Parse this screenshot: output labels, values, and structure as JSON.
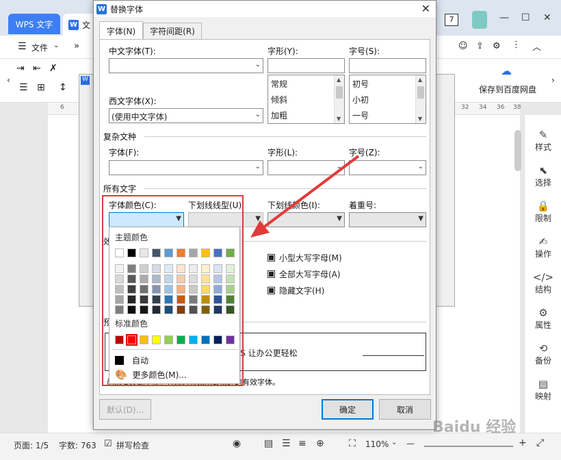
{
  "app": {
    "tab_wps": "WPS 文字",
    "tab_doc": "文",
    "menu_file": "文件",
    "tab_count": "7",
    "ribbon_save": "保存到百度网盘",
    "ruler_marks": [
      "6",
      "32",
      "34",
      "36",
      "38"
    ],
    "status_page": "页面: 1/5",
    "status_words": "字数: 763",
    "status_spell": "拼写检查",
    "status_zoom": "110%",
    "status_minus": "—",
    "status_plus": "+"
  },
  "sidebar": [
    {
      "icon": "✎",
      "label": "样式",
      "icon_name": "pen-icon"
    },
    {
      "icon": "⬉",
      "label": "选择",
      "icon_name": "cursor-icon"
    },
    {
      "icon": "🔒",
      "label": "限制",
      "icon_name": "lock-icon"
    },
    {
      "icon": "✍",
      "label": "操作",
      "icon_name": "edit-icon"
    },
    {
      "icon": "</>",
      "label": "结构",
      "icon_name": "code-icon"
    },
    {
      "icon": "⚙",
      "label": "属性",
      "icon_name": "properties-icon"
    },
    {
      "icon": "⟲",
      "label": "备份",
      "icon_name": "backup-icon"
    },
    {
      "icon": "▤",
      "label": "映射",
      "icon_name": "map-icon"
    }
  ],
  "dialog": {
    "title": "替换字体",
    "tab_font": "字体(N)",
    "tab_spacing": "字符间距(R)",
    "cn_font_label": "中文字体(T):",
    "style_label": "字形(Y):",
    "size_label": "字号(S):",
    "style_items": [
      "常规",
      "倾斜",
      "加粗"
    ],
    "size_items": [
      "初号",
      "小初",
      "一号"
    ],
    "west_font_label": "西文字体(X):",
    "west_font_value": "(使用中文字体)",
    "complex_section": "复杂文种",
    "complex_font_label": "字体(F):",
    "complex_style_label": "字形(L):",
    "complex_size_label": "字号(Z):",
    "all_text_section": "所有文字",
    "font_color_label": "字体颜色(C):",
    "underline_type_label": "下划线线型(U):",
    "underline_color_label": "下划线颜色(I):",
    "emphasis_label": "着重号:",
    "effects_section_partial": "效",
    "small_caps": "小型大写字母(M)",
    "all_caps": "全部大写字母(A)",
    "hidden": "隐藏文字(H)",
    "preview_section_partial": "预",
    "preview_text": "PS 让办公更轻松",
    "note_text": "尚未安装此字体，打印时将采用最相近的有效字体。",
    "btn_default": "默认(D)...",
    "btn_ok": "确定",
    "btn_cancel": "取消"
  },
  "color_popup": {
    "theme_title": "主题颜色",
    "standard_title": "标准颜色",
    "auto_label": "自动",
    "more_label": "更多颜色(M)...",
    "theme_row": [
      "#ffffff",
      "#000000",
      "#e7e6e6",
      "#44546a",
      "#5b9bd5",
      "#ed7d31",
      "#a5a5a5",
      "#ffc000",
      "#4472c4",
      "#70ad47"
    ],
    "shade_rows": [
      [
        "#f2f2f2",
        "#7f7f7f",
        "#d0cece",
        "#d6dce4",
        "#deebf6",
        "#fbe5d5",
        "#ededed",
        "#fff2cc",
        "#dae3f3",
        "#e2efd9"
      ],
      [
        "#d8d8d8",
        "#595959",
        "#aeaaaa",
        "#adb9ca",
        "#bdd7ee",
        "#f7cbac",
        "#dbdbdb",
        "#ffe598",
        "#b4c6e7",
        "#c5e0b3"
      ],
      [
        "#bfbfbf",
        "#3f3f3f",
        "#757070",
        "#8496b0",
        "#9cc3e5",
        "#f4b183",
        "#c9c9c9",
        "#ffd965",
        "#8eaadb",
        "#a8d08d"
      ],
      [
        "#a5a5a5",
        "#262626",
        "#3a3838",
        "#323f4f",
        "#2e75b5",
        "#c55a11",
        "#7b7b7b",
        "#bf8f00",
        "#2f5496",
        "#538135"
      ],
      [
        "#7f7f7f",
        "#0c0c0c",
        "#171616",
        "#222a35",
        "#1e4e79",
        "#833c0b",
        "#525252",
        "#7f6000",
        "#1f3864",
        "#375623"
      ]
    ],
    "standard_row": [
      "#c00000",
      "#ff0000",
      "#ffc000",
      "#ffff00",
      "#92d050",
      "#00b050",
      "#00b0f0",
      "#0070c0",
      "#002060",
      "#7030a0"
    ],
    "selected_standard_index": 1,
    "auto_color": "#000000"
  },
  "annotation_color": "#e23a3a",
  "watermark": "Baidu 经验"
}
